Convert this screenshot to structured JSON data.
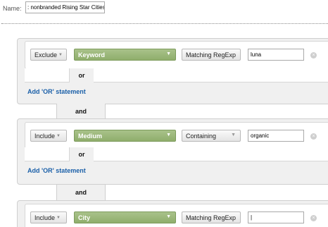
{
  "name": {
    "label": "Name:",
    "value": ": nonbranded Rising Star Cities"
  },
  "groups": [
    {
      "mode": "Exclude",
      "dimension": "Keyword",
      "match_type": "Matching RegExp",
      "value": "luna",
      "or_label": "or",
      "add_or_label": "Add 'OR' statement"
    },
    {
      "mode": "Include",
      "dimension": "Medium",
      "match_type": "Containing",
      "value": "organic",
      "or_label": "or",
      "add_or_label": "Add 'OR' statement"
    },
    {
      "mode": "Include",
      "dimension": "City",
      "match_type": "Matching RegExp",
      "value": "|"
    }
  ],
  "and_label": "and",
  "icons": {
    "mode_caret": "caret-down-icon",
    "dimension_caret": "caret-down-icon",
    "remove": "close-circle-icon"
  }
}
